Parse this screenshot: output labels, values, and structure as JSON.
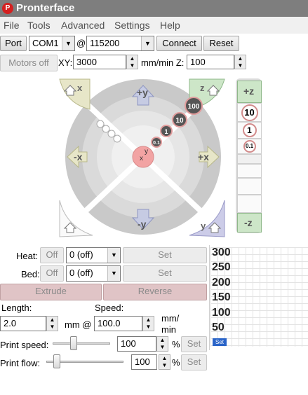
{
  "window": {
    "title": "Pronterface",
    "icon_text": "P"
  },
  "menu": [
    "File",
    "Tools",
    "Advanced",
    "Settings",
    "Help"
  ],
  "connection": {
    "port_label": "Port",
    "port_value": "COM1",
    "at_label": "@",
    "baud_value": "115200",
    "connect_label": "Connect",
    "reset_label": "Reset"
  },
  "motion": {
    "motors_off_label": "Motors off",
    "xy_label": "XY:",
    "xy_value": "3000",
    "unit_label": "mm/min Z:",
    "z_value": "100"
  },
  "jog": {
    "home_x": "x",
    "home_z": "z",
    "plus_y": "+y",
    "minus_y": "-y",
    "minus_x": "-x",
    "plus_x": "+x",
    "home_y": "y",
    "steps": [
      "100",
      "10",
      "1",
      "0.1"
    ],
    "center_y": "y",
    "center_x": "x",
    "z_plus": "+z",
    "z_minus": "-z",
    "z_steps": [
      "10",
      "1",
      "0.1"
    ]
  },
  "temps": {
    "heat_label": "Heat:",
    "bed_label": "Bed:",
    "off_label": "Off",
    "heat_value": "0 (off)",
    "bed_value": "0 (off)",
    "set_label": "Set"
  },
  "extrude": {
    "extrude_label": "Extrude",
    "reverse_label": "Reverse",
    "length_label": "Length:",
    "speed_label": "Speed:",
    "length_value": "2.0",
    "mm_at_label": "mm @",
    "speed_value": "100.0",
    "speed_unit_line1": "mm/",
    "speed_unit_line2": "min"
  },
  "print_controls": {
    "print_speed_label": "Print speed:",
    "print_speed_value": "100",
    "print_speed_slider_fraction": 0.35,
    "print_flow_label": "Print flow:",
    "print_flow_value": "100",
    "print_flow_slider_fraction": 0.1,
    "percent": "%",
    "set_label": "Set"
  },
  "graph": {
    "ticks": [
      "300",
      "250",
      "200",
      "150",
      "100",
      "50"
    ],
    "legend_text": "Set"
  },
  "colors": {
    "home_x_yellow": "#e7e6c8",
    "home_z_green": "#cde6c8",
    "home_y_purple": "#cccce8",
    "center_red": "#f2a3a3",
    "extrude_pink": "#e0c4c6"
  }
}
